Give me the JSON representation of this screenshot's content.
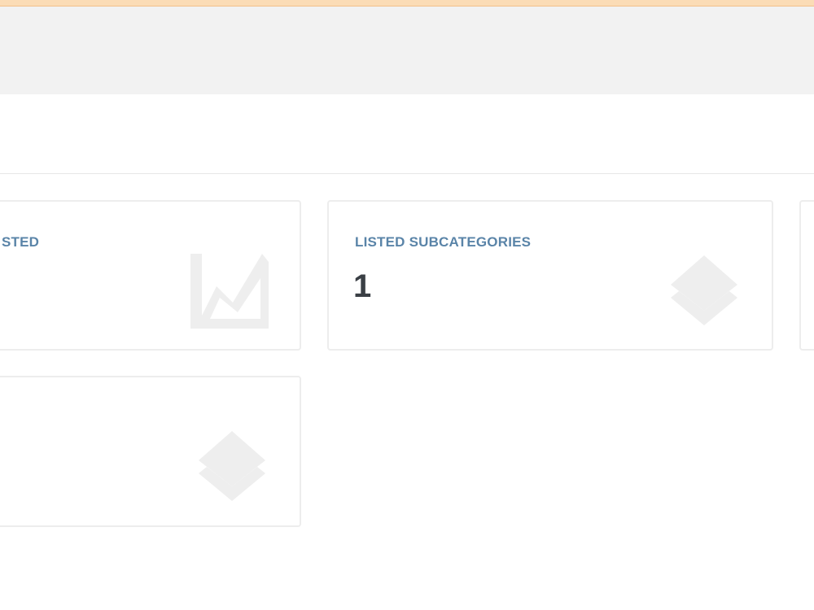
{
  "header": {},
  "cards": [
    {
      "label": "STED",
      "value": "",
      "icon": "line-chart-icon"
    },
    {
      "label": "LISTED SUBCATEGORIES",
      "value": "1",
      "icon": "layers-icon"
    },
    {
      "label": "",
      "value": "",
      "icon": ""
    },
    {
      "label": "",
      "value": "",
      "icon": "layers-icon"
    }
  ],
  "colors": {
    "top_strip": "#fbdcb6",
    "header_bg": "#f2f2f2",
    "label": "#5a84a8",
    "value": "#3a3f45",
    "icon": "#eeeeee",
    "card_border": "#ededed"
  }
}
